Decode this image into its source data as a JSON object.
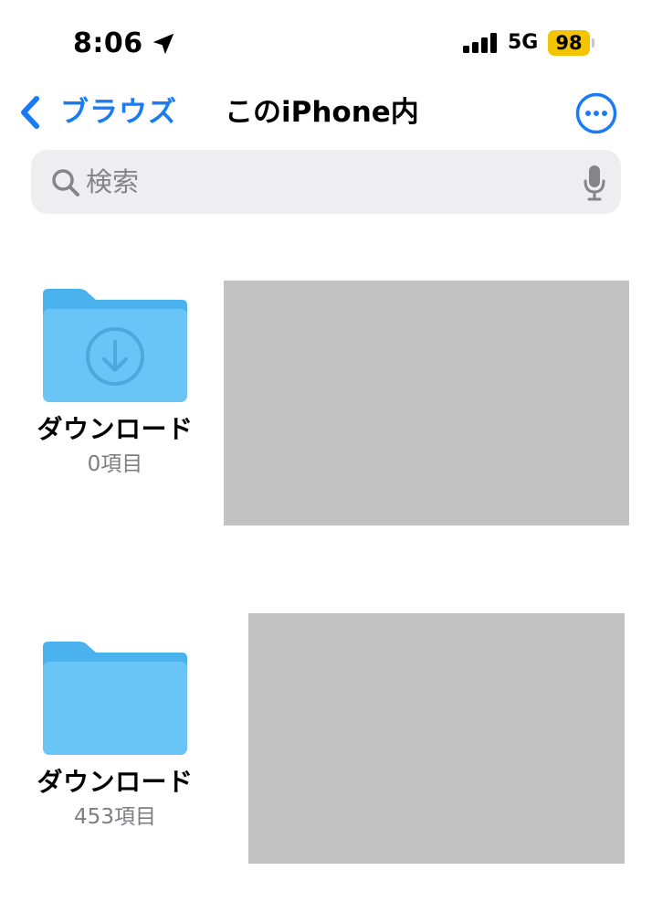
{
  "status_bar": {
    "time": "8:06",
    "network": "5G",
    "battery": "98",
    "battery_color": "#f5c400"
  },
  "nav": {
    "back_label": "ブラウズ",
    "title": "このiPhone内",
    "more_icon": "ellipsis-circle-icon",
    "accent_color": "#1a7cf5"
  },
  "search": {
    "placeholder": "検索",
    "value": ""
  },
  "files": [
    {
      "name": "ダウンロード",
      "count": "0項目",
      "icon": "folder-download-icon"
    },
    {
      "name": "ダウンロード",
      "count": "453項目",
      "icon": "folder-icon"
    }
  ],
  "colors": {
    "folder_back": "#4ab2ec",
    "folder_front": "#68c5f6",
    "redaction": "#c2c2c2"
  }
}
